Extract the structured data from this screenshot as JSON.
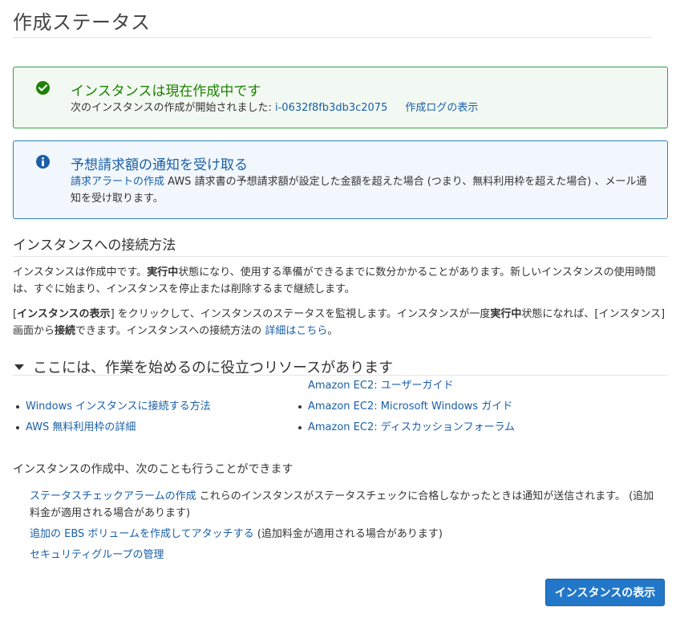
{
  "page_title": "作成ステータス",
  "success_alert": {
    "icon": "check-circle-icon",
    "title": "インスタンスは現在作成中です",
    "message": "次のインスタンスの作成が開始されました: ",
    "instance_id": "i-0632f8fb3db3c2075",
    "log_link": "作成ログの表示"
  },
  "info_alert": {
    "icon": "info-circle-icon",
    "title": "予想請求額の通知を受け取る",
    "link": "請求アラートの作成",
    "message": " AWS 請求書の予想請求額が設定した金額を超えた場合 (つまり、無料利用枠を超えた場合) 、メール通知を受け取ります。"
  },
  "connect": {
    "title": "インスタンスへの接続方法",
    "p1_a": "インスタンスは作成中です。",
    "p1_bold": "実行中",
    "p1_b": "状態になり、使用する準備ができるまでに数分かかることがあります。新しいインスタンスの使用時間は、すぐに始まり、インスタンスを停止または削除するまで継続します。",
    "p2_a": "[",
    "p2_bold1": "インスタンスの表示",
    "p2_b": "] をクリックして、インスタンスのステータスを監視します。インスタンスが一度",
    "p2_bold2": "実行中",
    "p2_c": "状態になれば、[インスタンス] 画面から",
    "p2_bold3": "接続",
    "p2_d": "できます。インスタンスへの接続方法の ",
    "p2_link": "詳細はこちら",
    "p2_e": "。"
  },
  "resources": {
    "title": "ここには、作業を始めるのに役立つリソースがあります",
    "left": [
      "Windows インスタンスに接続する方法",
      "AWS 無料利用枠の詳細"
    ],
    "right": [
      "Amazon EC2: ユーザーガイド",
      "Amazon EC2: Microsoft Windows ガイド",
      "Amazon EC2: ディスカッションフォーラム"
    ]
  },
  "also": {
    "title": "インスタンスの作成中、次のことも行うことができます",
    "item1_link": "ステータスチェックアラームの作成",
    "item1_text": " これらのインスタンスがステータスチェックに合格しなかったときは通知が送信されます。 (追加料金が適用される場合があります)",
    "item2_link": "追加の EBS ボリュームを作成してアタッチする",
    "item2_text": " (追加料金が適用される場合があります)",
    "item3_link": "セキュリティグループの管理"
  },
  "view_button": "インスタンスの表示"
}
